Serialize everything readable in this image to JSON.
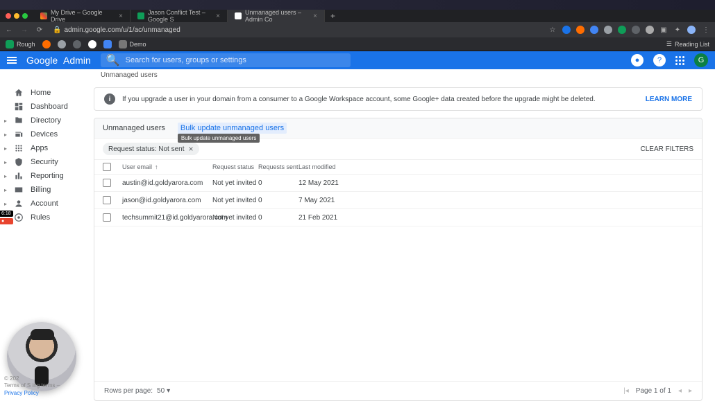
{
  "browser": {
    "tabs": [
      {
        "title": "My Drive – Google Drive"
      },
      {
        "title": "Jason Conflict Test – Google S"
      },
      {
        "title": "Unmanaged users – Admin Co"
      }
    ],
    "new_tab": "+",
    "url": "admin.google.com/u/1/ac/unmanaged",
    "bookmarks": [
      {
        "label": "Rough"
      },
      {
        "label": ""
      },
      {
        "label": ""
      },
      {
        "label": ""
      },
      {
        "label": ""
      },
      {
        "label": ""
      },
      {
        "label": "Demo"
      }
    ],
    "reading_list": "Reading List"
  },
  "header": {
    "brand_google": "Google",
    "brand_admin": "Admin",
    "search_placeholder": "Search for users, groups or settings",
    "avatar_letter": "G"
  },
  "breadcrumb": "Unmanaged users",
  "sidebar": {
    "items": [
      {
        "label": "Home"
      },
      {
        "label": "Dashboard"
      },
      {
        "label": "Directory",
        "expandable": true
      },
      {
        "label": "Devices",
        "expandable": true
      },
      {
        "label": "Apps",
        "expandable": true
      },
      {
        "label": "Security",
        "expandable": true
      },
      {
        "label": "Reporting",
        "expandable": true
      },
      {
        "label": "Billing",
        "expandable": true
      },
      {
        "label": "Account",
        "expandable": true
      },
      {
        "label": "Rules"
      }
    ],
    "time_tag": "6:18"
  },
  "banner": {
    "text": "If you upgrade a user in your domain from a consumer to a Google Workspace account, some Google+ data created before the upgrade might be deleted.",
    "learn_more": "LEARN MORE"
  },
  "panel": {
    "title": "Unmanaged users",
    "bulk_link": "Bulk update unmanaged users",
    "tooltip": "Bulk update unmanaged users",
    "filter_chip": "Request status: Not sent",
    "clear_filters": "CLEAR FILTERS",
    "columns": {
      "email": "User email",
      "status": "Request status",
      "sent": "Requests sent",
      "modified": "Last modified"
    },
    "rows": [
      {
        "email": "austin@id.goldyarora.com",
        "status": "Not yet invited",
        "sent": "0",
        "modified": "12 May 2021"
      },
      {
        "email": "jason@id.goldyarora.com",
        "status": "Not yet invited",
        "sent": "0",
        "modified": "7 May 2021"
      },
      {
        "email": "techsummit21@id.goldyarora.com",
        "status": "Not yet invited",
        "sent": "0",
        "modified": "21 Feb 2021"
      }
    ],
    "footer": {
      "rows_per_page": "Rows per page:",
      "page_size": "50",
      "page_label": "Page 1 of 1"
    }
  },
  "footer_links": {
    "copyright": "© 202",
    "terms": "Terms of S",
    "ing": "ing terms –",
    "privacy": "Privacy Policy"
  }
}
